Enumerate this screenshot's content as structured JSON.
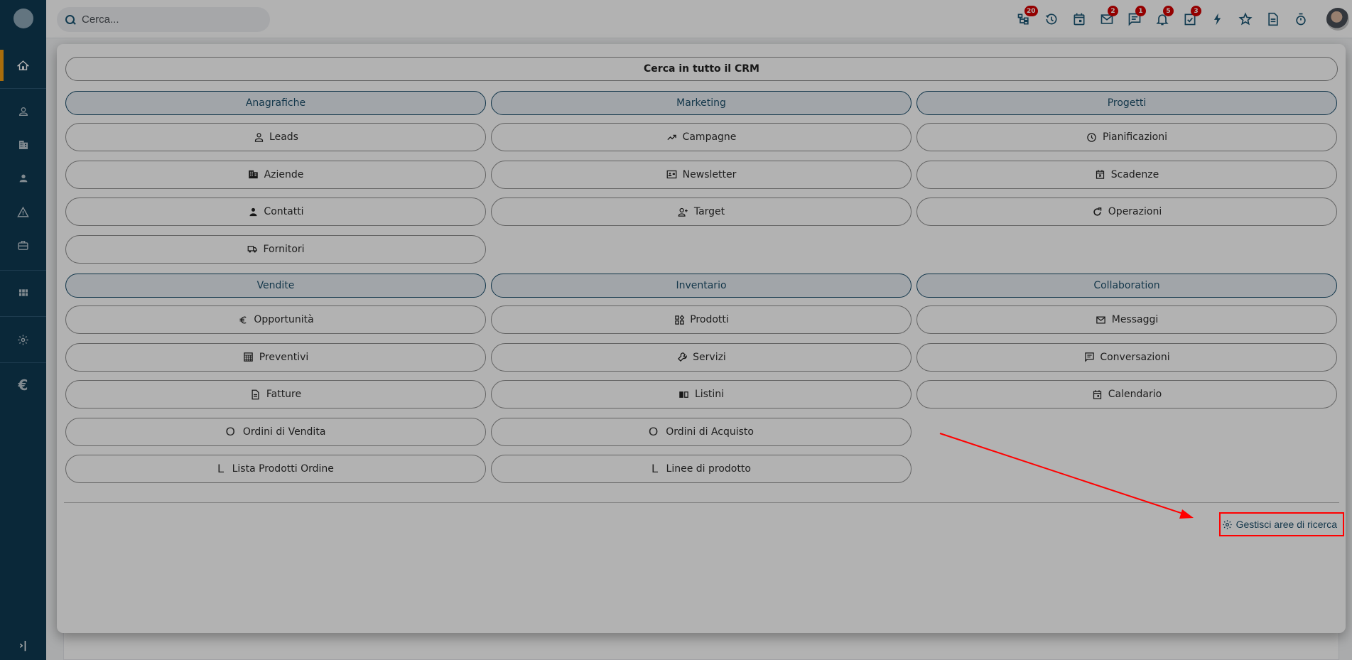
{
  "sidebar": {
    "items": [
      {
        "name": "home",
        "icon": "home-icon",
        "active": true
      },
      {
        "name": "leads",
        "icon": "person-outline-icon"
      },
      {
        "name": "aziende",
        "icon": "building-icon"
      },
      {
        "name": "contatti",
        "icon": "person-icon"
      },
      {
        "name": "alerts",
        "icon": "warning-icon"
      },
      {
        "name": "briefcase",
        "icon": "briefcase-icon"
      },
      {
        "name": "grid",
        "icon": "grid-icon"
      },
      {
        "name": "settings",
        "icon": "gear-icon"
      },
      {
        "name": "euro",
        "icon": "euro-icon"
      }
    ],
    "glyphs": {
      "home": "⌂",
      "euro": "€",
      "collapse": "›|"
    }
  },
  "topbar": {
    "search_placeholder": "Cerca...",
    "icons": [
      {
        "name": "hierarchy-icon",
        "badge": "20"
      },
      {
        "name": "history-icon",
        "badge": null
      },
      {
        "name": "calendar-icon",
        "badge": null
      },
      {
        "name": "mail-icon",
        "badge": "2"
      },
      {
        "name": "chat-icon",
        "badge": "1"
      },
      {
        "name": "bell-icon",
        "badge": "5"
      },
      {
        "name": "task-icon",
        "badge": "3"
      },
      {
        "name": "lightning-icon",
        "badge": null
      },
      {
        "name": "star-icon",
        "badge": null
      },
      {
        "name": "document-icon",
        "badge": null
      },
      {
        "name": "stopwatch-icon",
        "badge": null
      }
    ],
    "badge_color": "#d40000"
  },
  "search_panel": {
    "title": "Cerca in tutto il CRM",
    "sections": [
      {
        "columns": [
          {
            "category": "Anagrafiche",
            "items": [
              {
                "label": "Leads",
                "icon": "person-outline-icon"
              },
              {
                "label": "Aziende",
                "icon": "building-icon"
              },
              {
                "label": "Contatti",
                "icon": "person-icon"
              },
              {
                "label": "Fornitori",
                "icon": "truck-icon"
              }
            ]
          },
          {
            "category": "Marketing",
            "items": [
              {
                "label": "Campagne",
                "icon": "trending-up-icon"
              },
              {
                "label": "Newsletter",
                "icon": "id-card-icon"
              },
              {
                "label": "Target",
                "icon": "person-add-icon"
              }
            ]
          },
          {
            "category": "Progetti",
            "items": [
              {
                "label": "Pianificazioni",
                "icon": "clock-icon"
              },
              {
                "label": "Scadenze",
                "icon": "calendar-x-icon"
              },
              {
                "label": "Operazioni",
                "icon": "refresh-icon"
              }
            ]
          }
        ]
      },
      {
        "columns": [
          {
            "category": "Vendite",
            "items": [
              {
                "label": "Opportunità",
                "icon": "euro-icon"
              },
              {
                "label": "Preventivi",
                "icon": "calculator-icon"
              },
              {
                "label": "Fatture",
                "icon": "document-icon"
              },
              {
                "label": "Ordini di Vendita",
                "letter": "O"
              },
              {
                "label": "Lista Prodotti Ordine",
                "letter": "L"
              }
            ]
          },
          {
            "category": "Inventario",
            "items": [
              {
                "label": "Prodotti",
                "icon": "widgets-icon"
              },
              {
                "label": "Servizi",
                "icon": "wrench-icon"
              },
              {
                "label": "Listini",
                "icon": "book-icon"
              },
              {
                "label": "Ordini di Acquisto",
                "letter": "O"
              },
              {
                "label": "Linee di prodotto",
                "letter": "L"
              }
            ]
          },
          {
            "category": "Collaboration",
            "items": [
              {
                "label": "Messaggi",
                "icon": "mail-icon"
              },
              {
                "label": "Conversazioni",
                "icon": "chat-icon"
              },
              {
                "label": "Calendario",
                "icon": "calendar-icon"
              }
            ]
          }
        ]
      }
    ],
    "manage_link": "Gestisci aree di ricerca"
  },
  "annotation": {
    "color": "#ff0000",
    "target": "Gestisci aree di ricerca"
  }
}
